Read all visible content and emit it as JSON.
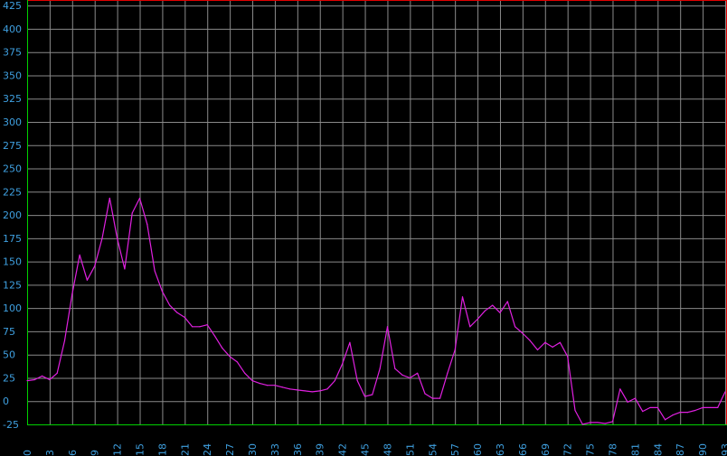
{
  "chart_data": {
    "type": "line",
    "title": "",
    "xlabel": "",
    "ylabel": "",
    "xlim": [
      0,
      93
    ],
    "ylim": [
      -25,
      430
    ],
    "grid": true,
    "y_ticks": [
      -25,
      0,
      25,
      50,
      75,
      100,
      125,
      150,
      175,
      200,
      225,
      250,
      275,
      300,
      325,
      350,
      375,
      400,
      425
    ],
    "x_ticks": [
      0,
      3,
      6,
      9,
      12,
      15,
      18,
      21,
      24,
      27,
      30,
      33,
      36,
      39,
      42,
      45,
      48,
      51,
      54,
      57,
      60,
      63,
      66,
      69,
      72,
      75,
      78,
      81,
      84,
      87,
      90,
      93
    ],
    "series": [
      {
        "color": "#e020e0",
        "x": [
          0,
          1,
          2,
          3,
          4,
          5,
          6,
          7,
          8,
          9,
          10,
          11,
          12,
          13,
          14,
          15,
          16,
          17,
          18,
          19,
          20,
          21,
          22,
          23,
          24,
          25,
          26,
          27,
          28,
          29,
          30,
          31,
          32,
          33,
          34,
          35,
          36,
          37,
          38,
          39,
          40,
          41,
          42,
          43,
          44,
          45,
          46,
          47,
          48,
          49,
          50,
          51,
          52,
          53,
          54,
          55,
          56,
          57,
          58,
          59,
          60,
          61,
          62,
          63,
          64,
          65,
          66,
          67,
          68,
          69,
          70,
          71,
          72,
          73,
          74,
          75,
          76,
          77,
          78,
          79,
          80,
          81,
          82,
          83,
          84,
          85,
          86,
          87,
          88,
          89,
          90,
          91,
          92,
          93
        ],
        "values": [
          22,
          23,
          27,
          23,
          30,
          65,
          115,
          157,
          130,
          145,
          175,
          218,
          175,
          142,
          202,
          218,
          190,
          140,
          118,
          103,
          95,
          90,
          80,
          80,
          82,
          70,
          57,
          48,
          42,
          30,
          22,
          19,
          17,
          17,
          15,
          13,
          12,
          11,
          10,
          11,
          13,
          22,
          40,
          63,
          22,
          5,
          7,
          35,
          80,
          35,
          28,
          25,
          30,
          8,
          3,
          3,
          30,
          55,
          112,
          80,
          88,
          97,
          103,
          95,
          107,
          80,
          73,
          65,
          55,
          63,
          58,
          63,
          48,
          -10,
          -25,
          -23,
          -23,
          -24,
          -22,
          13,
          -1,
          3,
          -11,
          -7,
          -7,
          -20,
          -15,
          -12,
          -12,
          -10,
          -7,
          -7,
          -7,
          10
        ]
      }
    ]
  },
  "colors": {
    "background": "#000000",
    "grid": "#8a8a8a",
    "top_border": "#e00000",
    "right_border": "#e00000",
    "bottom_axis": "#00d000",
    "left_axis": "#00d000",
    "tick_labels": "#3fa0e0",
    "line": "#e020e0"
  }
}
